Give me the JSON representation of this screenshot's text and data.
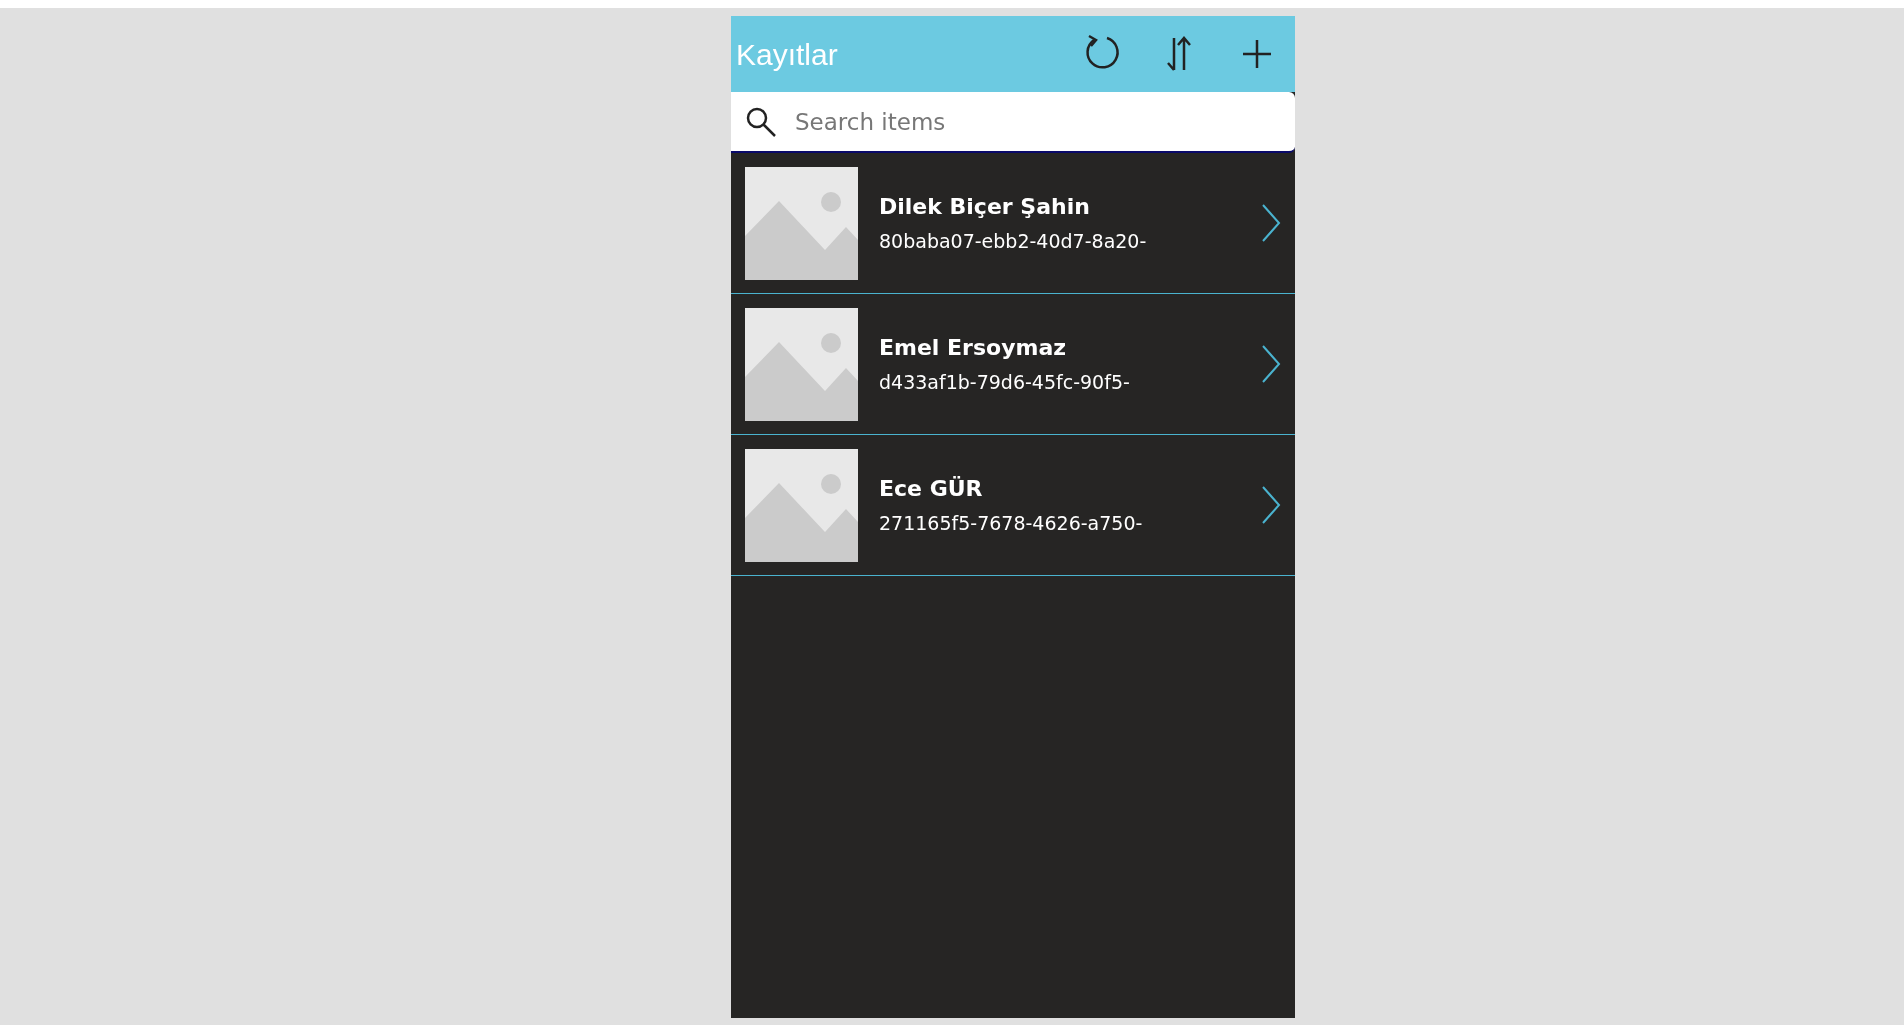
{
  "header": {
    "title": "Kayıtlar"
  },
  "search": {
    "placeholder": "Search items"
  },
  "items": [
    {
      "name": "Dilek Biçer Şahin",
      "id": "80baba07-ebb2-40d7-8a20-"
    },
    {
      "name": "Emel Ersoymaz",
      "id": "d433af1b-79d6-45fc-90f5-"
    },
    {
      "name": "Ece GÜR",
      "id": "271165f5-7678-4626-a750-"
    }
  ]
}
